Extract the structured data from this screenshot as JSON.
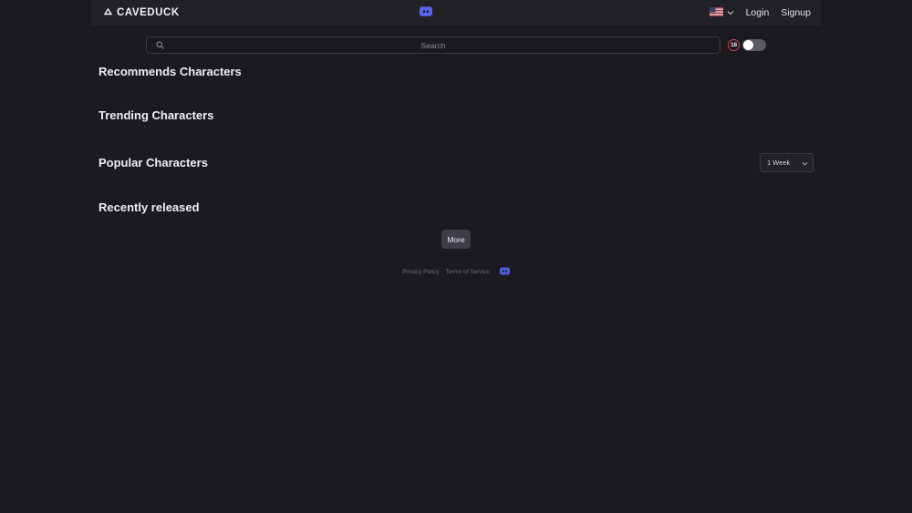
{
  "colors": {
    "page_bg": "#1b1b1f",
    "header_bg": "#212126",
    "text_primary": "#efeff2",
    "text_muted": "#8b8b94",
    "discord_blue": "#5865f2",
    "badge_red": "#d9434f",
    "button_gray": "#3e3e46"
  },
  "header": {
    "logo_icon": "mountain-triangle-icon",
    "logo_text": "CAVEDUCK",
    "discord_icon": "discord-icon",
    "language": {
      "flag_icon": "us-flag-icon",
      "chevron_icon": "chevron-down-icon"
    },
    "login_label": "Login",
    "signup_label": "Signup"
  },
  "search": {
    "icon": "search-icon",
    "placeholder": "Search",
    "value": "",
    "nsfw_badge_label": "18",
    "nsfw_toggle_state": "off"
  },
  "sections": [
    {
      "title": "Recommends Characters"
    },
    {
      "title": "Trending Characters"
    },
    {
      "title": "Popular Characters"
    },
    {
      "title": "Recently released"
    }
  ],
  "period_filter": {
    "selected": "1 Week",
    "chevron_icon": "chevron-down-icon",
    "options": [
      "1 Week"
    ]
  },
  "more_button": {
    "label": "More"
  },
  "footer": {
    "privacy_label": "Privacy Policy",
    "terms_label": "Terms of Service",
    "discord_icon": "discord-icon"
  }
}
